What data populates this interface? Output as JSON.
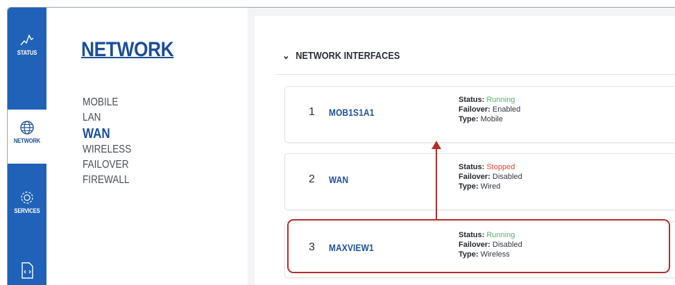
{
  "rail": {
    "items": [
      {
        "label": "STATUS",
        "icon": "status-icon"
      },
      {
        "label": "NETWORK",
        "icon": "globe-icon"
      },
      {
        "label": "SERVICES",
        "icon": "services-icon"
      },
      {
        "label": "",
        "icon": "file-code-icon"
      }
    ]
  },
  "submenu": {
    "title": "NETWORK",
    "items": [
      "MOBILE",
      "LAN",
      "WAN",
      "WIRELESS",
      "FAILOVER",
      "FIREWALL"
    ],
    "active": "WAN"
  },
  "section": {
    "title": "NETWORK INTERFACES"
  },
  "interfaces": [
    {
      "num": "1",
      "name": "MOB1S1A1",
      "status_label": "Status:",
      "status": "Running",
      "failover_label": "Failover:",
      "failover": "Enabled",
      "type_label": "Type:",
      "type": "Mobile"
    },
    {
      "num": "2",
      "name": "WAN",
      "status_label": "Status:",
      "status": "Stopped",
      "failover_label": "Failover:",
      "failover": "Disabled",
      "type_label": "Type:",
      "type": "Wired"
    },
    {
      "num": "3",
      "name": "MAXVIEW1",
      "status_label": "Status:",
      "status": "Running",
      "failover_label": "Failover:",
      "failover": "Disabled",
      "type_label": "Type:",
      "type": "Wireless"
    }
  ],
  "colors": {
    "accent": "#1f62b8",
    "running": "#52b36a",
    "stopped": "#e0442e",
    "annotation": "#b32d2d"
  }
}
